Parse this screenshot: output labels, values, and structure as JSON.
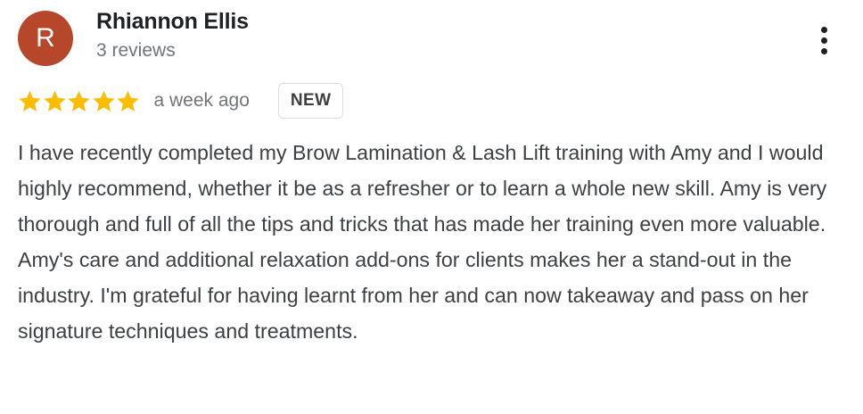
{
  "review": {
    "avatar_initial": "R",
    "avatar_color": "#b7472a",
    "author_name": "Rhiannon Ellis",
    "review_count": "3 reviews",
    "rating": 5,
    "rating_max": 5,
    "star_color": "#fbbc04",
    "date": "a week ago",
    "badge": "NEW",
    "text": "I have recently completed my Brow Lamination & Lash Lift training with Amy and I would highly recommend, whether it be as a refresher or to learn a whole new skill. Amy is very thorough and full of all the tips and tricks that has made her training even more valuable.\nAmy's care and additional relaxation add-ons for clients makes her a stand-out in the industry. I'm grateful for having learnt from her and can now takeaway and pass on her signature techniques and treatments."
  },
  "icons": {
    "more": "more-vert-icon",
    "star": "star-icon"
  }
}
